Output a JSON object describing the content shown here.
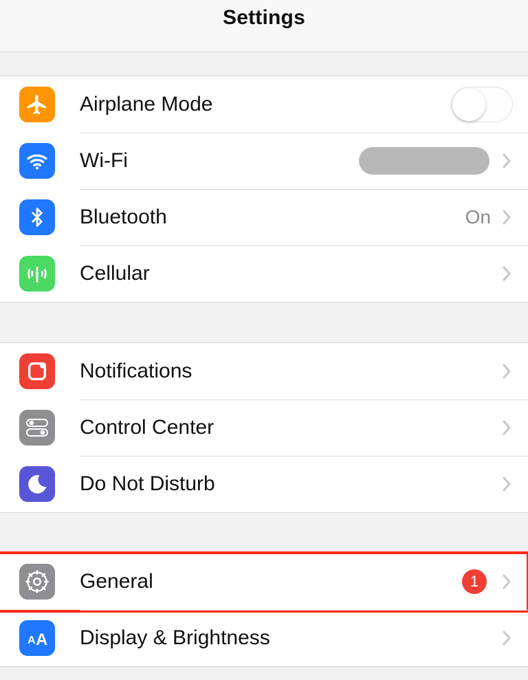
{
  "header": {
    "title": "Settings"
  },
  "group1": [
    {
      "id": "airplane",
      "label": "Airplane Mode",
      "toggle": false
    },
    {
      "id": "wifi",
      "label": "Wi-Fi",
      "value_redacted": true
    },
    {
      "id": "bluetooth",
      "label": "Bluetooth",
      "value": "On"
    },
    {
      "id": "cellular",
      "label": "Cellular"
    }
  ],
  "group2": [
    {
      "id": "notifications",
      "label": "Notifications"
    },
    {
      "id": "controlcenter",
      "label": "Control Center"
    },
    {
      "id": "dnd",
      "label": "Do Not Disturb"
    }
  ],
  "group3": [
    {
      "id": "general",
      "label": "General",
      "badge": "1",
      "highlighted": true
    },
    {
      "id": "display",
      "label": "Display & Brightness"
    }
  ],
  "icon_colors": {
    "airplane": "#ff9500",
    "wifi": "#1f78ff",
    "bluetooth": "#1f78ff",
    "cellular": "#4cd964",
    "notifications": "#ef3f34",
    "controlcenter": "#8e8e93",
    "dnd": "#5856d6",
    "general": "#8e8e93",
    "display": "#1f78ff"
  }
}
